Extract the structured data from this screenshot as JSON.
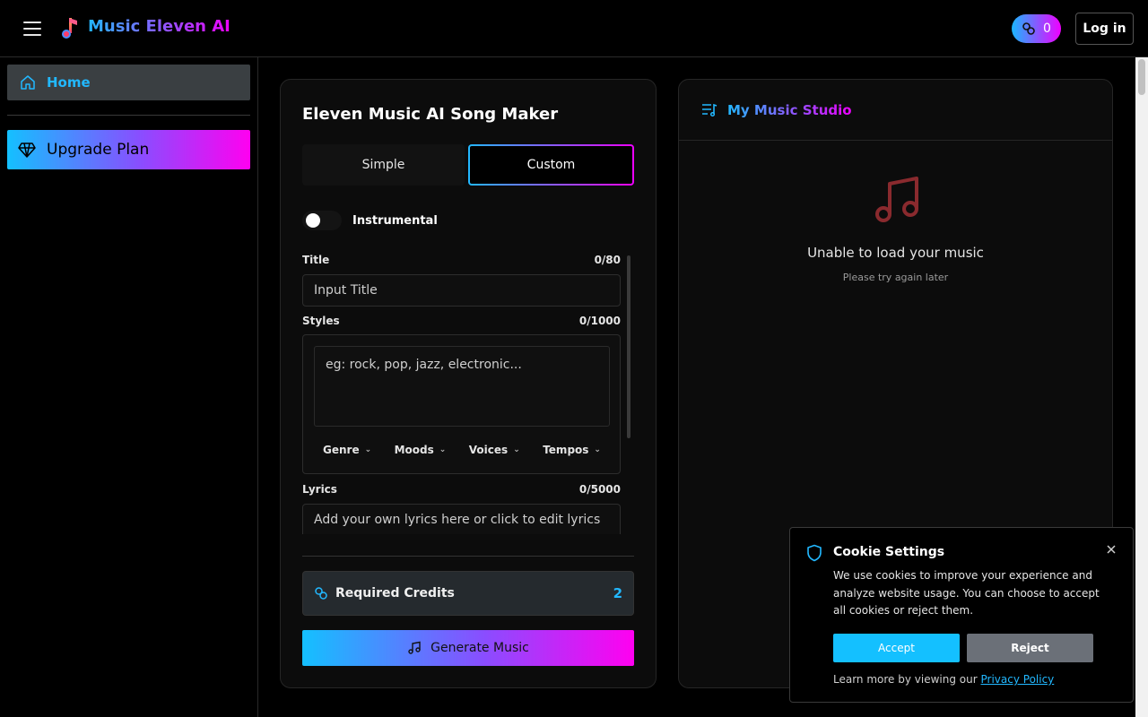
{
  "header": {
    "brand": "Music Eleven AI",
    "credits_count": "0",
    "login_label": "Log in"
  },
  "sidebar": {
    "home_label": "Home",
    "upgrade_label": "Upgrade Plan"
  },
  "maker": {
    "title": "Eleven Music AI Song Maker",
    "tabs": [
      "Simple",
      "Custom"
    ],
    "active_tab": "Custom",
    "instrumental_label": "Instrumental",
    "instrumental_on": false,
    "title_field": {
      "label": "Title",
      "counter": "0/80",
      "placeholder": "Input Title"
    },
    "styles_field": {
      "label": "Styles",
      "counter": "0/1000",
      "placeholder": "eg: rock, pop, jazz, electronic..."
    },
    "style_chips": [
      "Genre",
      "Moods",
      "Voices",
      "Tempos"
    ],
    "lyrics_field": {
      "label": "Lyrics",
      "counter": "0/5000",
      "placeholder": "Add your own lyrics here or click to edit lyrics"
    },
    "required_credits_label": "Required Credits",
    "required_credits_value": "2",
    "generate_label": "Generate Music"
  },
  "studio": {
    "title": "My Music Studio",
    "empty_title": "Unable to load your music",
    "empty_subtitle": "Please try again later"
  },
  "cookie": {
    "title": "Cookie Settings",
    "text": "We use cookies to improve your experience and analyze website usage. You can choose to accept all cookies or reject them.",
    "accept_label": "Accept",
    "reject_label": "Reject",
    "learn_prefix": "Learn more by viewing our",
    "policy_link": "Privacy Policy"
  },
  "colors": {
    "accent_blue": "#22b8ff",
    "accent_magenta": "#ee00ff",
    "background": "#000000"
  },
  "icons": [
    "menu-icon",
    "music-note-logo-icon",
    "link-credits-icon",
    "home-icon",
    "diamond-icon",
    "music-note-icon",
    "playlist-icon",
    "shield-icon",
    "close-icon"
  ]
}
